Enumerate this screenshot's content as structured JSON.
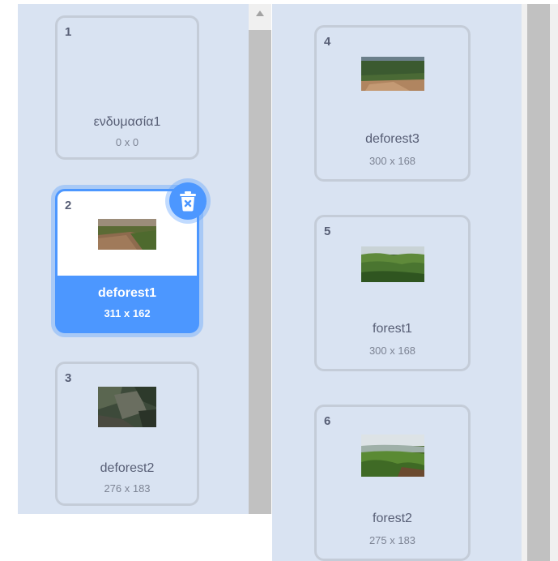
{
  "costumes": [
    {
      "number": "1",
      "name": "ενδυμασία1",
      "size": "0 x 0"
    },
    {
      "number": "2",
      "name": "deforest1",
      "size": "311 x 162"
    },
    {
      "number": "3",
      "name": "deforest2",
      "size": "276 x 183"
    },
    {
      "number": "4",
      "name": "deforest3",
      "size": "300 x 168"
    },
    {
      "number": "5",
      "name": "forest1",
      "size": "300 x 168"
    },
    {
      "number": "6",
      "name": "forest2",
      "size": "275 x 183"
    }
  ],
  "selected_costume": "2",
  "icons": {
    "delete": "trash-icon",
    "scroll_up": "scroll-up-arrow-icon"
  },
  "colors": {
    "panel_bg": "#d9e3f2",
    "selected": "#4c97ff",
    "tile_border": "#c4ccd8",
    "text": "#575e75"
  }
}
